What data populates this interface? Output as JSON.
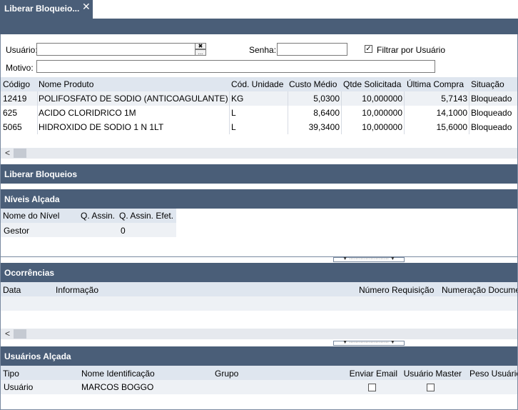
{
  "tab": {
    "title": "Liberar Bloqueio...",
    "close_glyph": "✕"
  },
  "filter": {
    "usuario_label": "Usuário:",
    "usuario_value": "",
    "clear_glyph": "✖",
    "more_glyph": "...",
    "senha_label": "Senha:",
    "senha_value": "",
    "filtrar_checked": true,
    "filtrar_label": "Filtrar por Usuário",
    "motivo_label": "Motivo:",
    "motivo_value": ""
  },
  "products": {
    "headers": [
      "Código",
      "Nome Produto",
      "Cód. Unidade",
      "Custo Médio",
      "Qtde Solicitada",
      "Última Compra",
      "Situação"
    ],
    "rows": [
      [
        "12419",
        "POLIFOSFATO DE SODIO (ANTICOAGULANTE)",
        "KG",
        "5,0300",
        "10,000000",
        "5,7143",
        "Bloqueado"
      ],
      [
        "625",
        "ACIDO CLORIDRICO 1M",
        "L",
        "8,6400",
        "10,000000",
        "14,1000",
        "Bloqueado"
      ],
      [
        "5065",
        "HIDROXIDO DE SODIO 1 N 1LT",
        "L",
        "39,3400",
        "10,000000",
        "15,6000",
        "Bloqueado"
      ]
    ]
  },
  "liberar_section": {
    "title": "Liberar Bloqueios"
  },
  "niveis": {
    "title": "Níveis Alçada",
    "headers": [
      "Nome do Nível",
      "Q. Assin.",
      "Q. Assin. Efet."
    ],
    "rows": [
      [
        "Gestor",
        "",
        "0"
      ]
    ]
  },
  "ocorrencias": {
    "title": "Ocorrências",
    "headers": [
      "Data",
      "Informação",
      "Número Requisição",
      "Numeração Documento"
    ]
  },
  "usuarios": {
    "title": "Usuários Alçada",
    "headers": [
      "Tipo",
      "Nome Identificação",
      "Grupo",
      "Enviar Email",
      "Usuário Master",
      "Peso Usuário"
    ],
    "rows": [
      {
        "tipo": "Usuário",
        "nome": "MARCOS BOGGO",
        "grupo": "",
        "enviar_email": false,
        "usuario_master": false
      }
    ]
  },
  "scroll": {
    "left_glyph": "<",
    "splitter_glyph": "▼ ························ ▼"
  },
  "colors": {
    "header_band": "#4a5e78",
    "table_header": "#dfe6ef",
    "row_stripe": "#eef1f5"
  }
}
